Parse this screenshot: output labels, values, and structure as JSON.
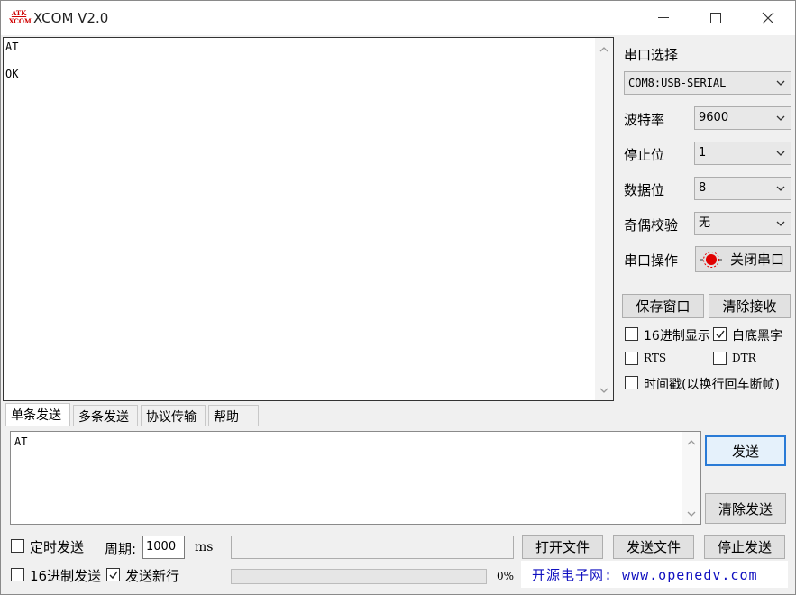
{
  "window": {
    "title": "XCOM V2.0",
    "logo_text_top": "ATK",
    "logo_text_bottom": "XCOM"
  },
  "receive": {
    "lines": [
      "AT",
      "OK"
    ]
  },
  "settings": {
    "port_label": "串口选择",
    "port_value": "COM8:USB-SERIAL",
    "baud_label": "波特率",
    "baud_value": "9600",
    "stop_label": "停止位",
    "stop_value": "1",
    "data_label": "数据位",
    "data_value": "8",
    "parity_label": "奇偶校验",
    "parity_value": "无",
    "op_label": "串口操作",
    "op_button": "关闭串口",
    "save_button": "保存窗口",
    "clear_recv_button": "清除接收",
    "hex_display_label": "16进制显示",
    "hex_display_checked": false,
    "white_bg_label": "白底黑字",
    "white_bg_checked": true,
    "rts_label": "RTS",
    "rts_checked": false,
    "dtr_label": "DTR",
    "dtr_checked": false,
    "timestamp_label": "时间戳(以换行回车断帧)",
    "timestamp_checked": false
  },
  "tabs": [
    {
      "label": "单条发送",
      "active": true
    },
    {
      "label": "多条发送",
      "active": false
    },
    {
      "label": "协议传输",
      "active": false
    },
    {
      "label": "帮助",
      "active": false
    }
  ],
  "send": {
    "text": "AT",
    "send_button": "发送",
    "clear_send_button": "清除发送"
  },
  "bottom": {
    "timed_send_label": "定时发送",
    "timed_send_checked": false,
    "period_label": "周期:",
    "period_value": "1000",
    "period_unit": "ms",
    "hex_send_label": "16进制发送",
    "hex_send_checked": false,
    "newline_label": "发送新行",
    "newline_checked": true,
    "open_file_button": "打开文件",
    "send_file_button": "发送文件",
    "stop_send_button": "停止发送",
    "progress_percent": "0%",
    "progress_value": 0,
    "banner_text": "开源电子网: www.openedv.com"
  },
  "colors": {
    "accent_border": "#2a7bd6",
    "led_red": "#e00000",
    "banner_text": "#1010c0"
  }
}
